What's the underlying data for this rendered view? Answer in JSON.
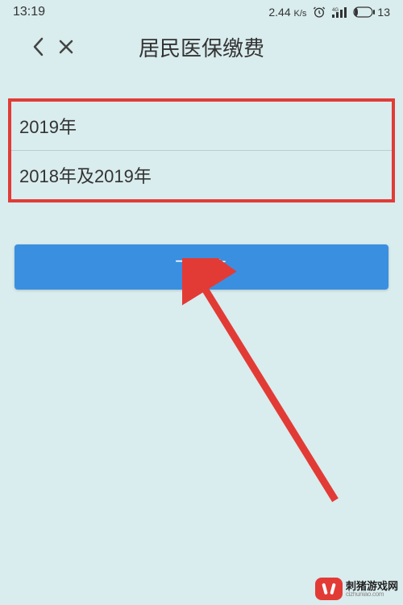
{
  "status_bar": {
    "time": "13:19",
    "net_speed_value": "2.44",
    "net_speed_unit": "K/s",
    "battery_value": "13"
  },
  "nav": {
    "title": "居民医保缴费"
  },
  "options": [
    {
      "label": "2019年"
    },
    {
      "label": "2018年及2019年"
    }
  ],
  "buttons": {
    "next": "下一步"
  },
  "annotation": {
    "highlight_color": "#e23b36",
    "arrow_color": "#e23b36"
  },
  "watermark": {
    "cn": "刺猪游戏网",
    "en": "cizhuniao.com"
  }
}
